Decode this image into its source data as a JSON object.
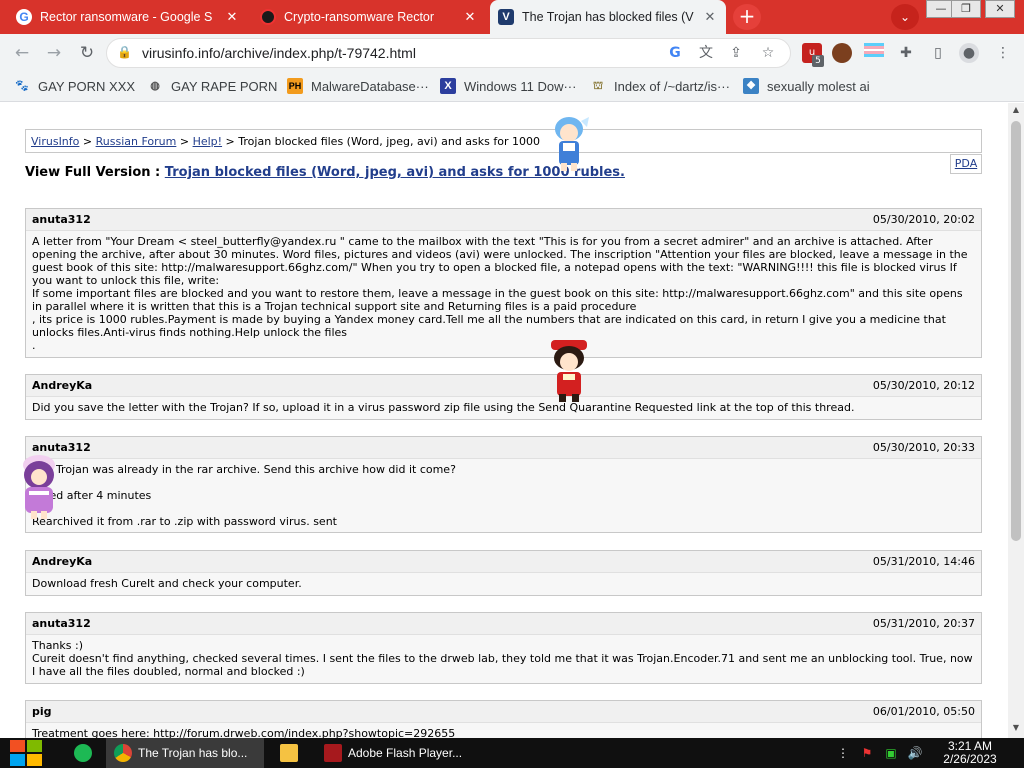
{
  "browser": {
    "tabs": [
      {
        "title": "Rector ransomware - Google S",
        "icon": "google-icon"
      },
      {
        "title": "Crypto-ransomware Rector",
        "icon": "site-icon"
      },
      {
        "title": "The Trojan has blocked files (V",
        "icon": "virusinfo-icon"
      }
    ],
    "new_tab_label": "+",
    "tab_search_label": "⌄",
    "window_controls": {
      "minimize": "—",
      "restore": "❐",
      "close": "✕"
    },
    "nav": {
      "back": "←",
      "forward": "→",
      "reload": "↻"
    },
    "lock_symbol": "🔒",
    "url": "virusinfo.info/archive/index.php/t-79742.html",
    "extension_badge": "5",
    "bookmarks": [
      {
        "label": "GAY PORN XXX",
        "icon": "paw-icon"
      },
      {
        "label": "GAY RAPE PORN",
        "icon": "globe-icon"
      },
      {
        "label": "MalwareDatabase···",
        "icon": "ph-icon",
        "icon_text": "PH"
      },
      {
        "label": "Windows 11 Dow···",
        "icon": "x-icon",
        "icon_text": "X"
      },
      {
        "label": "Index of /~dartz/is···",
        "icon": "folder-icon"
      },
      {
        "label": "sexually molest ai",
        "icon": "app-icon"
      }
    ]
  },
  "page": {
    "breadcrumb": {
      "home": "VirusInfo",
      "sep1": " > ",
      "forum": "Russian Forum",
      "sep2": " > ",
      "section": "Help!",
      "sep3": " > ",
      "current": "Trojan blocked files (Word, jpeg, avi) and asks for 1000"
    },
    "pda_label": "PDA",
    "view_full_prefix": "View Full Version : ",
    "view_full_link": "Trojan blocked files (Word, jpeg, avi) and asks for 1000 rubles.",
    "posts": [
      {
        "author": "anuta312",
        "date": "05/30/2010, 20:02",
        "body": "A letter from \"Your Dream < steel_butterfly@yandex.ru \" came to the mailbox with the text \"This is for you from a secret admirer\" and an archive is attached. After opening the archive, after about 30 minutes. Word files, pictures and videos (avi) were unlocked. The inscription \"Attention your files are blocked, leave a message in the guest book of this site: http://malwaresupport.66ghz.com/\" When you try to open a blocked file, a notepad opens with the text: \"WARNING!!!! this file is blocked virus If you want to unlock this file, write:\nIf some important files are blocked and you want to restore them, leave a message in the guest book on this site: http://malwaresupport.66ghz.com\" and this site opens in parallel where it is written that this is a Trojan technical support site and Returning files is a paid procedure\n, its price is 1000 rubles.Payment is made by buying a Yandex money card.Tell me all the numbers that are indicated on this card, in return I give you a medicine that unlocks files.Anti-virus finds nothing.Help unlock the files\n."
      },
      {
        "author": "AndreyKa",
        "date": "05/30/2010, 20:12",
        "body": "Did you save the letter with the Trojan? If so, upload it in a virus password zip file using the Send Quarantine Requested link at the top of this thread."
      },
      {
        "author": "anuta312",
        "date": "05/30/2010, 20:33",
        "body": "The Trojan was already in the rar archive. Send this archive how did it come?\n\n     ed after 4 minutes\n\nRearchived it from .rar to .zip with password virus. sent"
      },
      {
        "author": "AndreyKa",
        "date": "05/31/2010, 14:46",
        "body": "Download fresh CureIt and check your computer."
      },
      {
        "author": "anuta312",
        "date": "05/31/2010, 20:37",
        "body": "Thanks :)\nCureit doesn't find anything, checked several times. I sent the files to the drweb lab, they told me that it was Trojan.Encoder.71 and sent me an unblocking tool. True, now I have all the files doubled, normal and blocked :)"
      },
      {
        "author": "pig",
        "date": "06/01/2010, 05:50",
        "body": "Treatment goes here: http://forum.drweb.com/index.php?showtopic=292655"
      }
    ]
  },
  "taskbar": {
    "items": [
      {
        "label": "The Trojan has blo...",
        "icon": "chrome-icon"
      },
      {
        "label": "Adobe Flash Player...",
        "icon": "flash-icon"
      }
    ],
    "clock_time": "3:21 AM",
    "clock_date": "2/26/2023"
  },
  "colors": {
    "tab_strip": "#d8332b",
    "link": "#223e8c"
  }
}
